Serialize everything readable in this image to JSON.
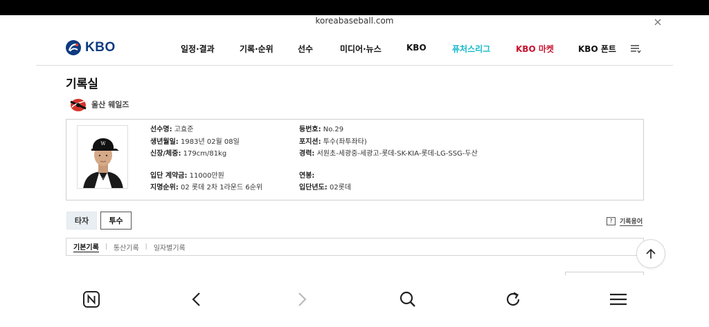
{
  "browser": {
    "url": "koreabaseball.com",
    "close_icon": "close-icon",
    "toolbar": [
      "naver-icon",
      "back-icon",
      "forward-icon",
      "search-icon",
      "refresh-icon",
      "menu-icon"
    ]
  },
  "site": {
    "logo_text": "KBO",
    "nav": {
      "schedule": "일정·결과",
      "records": "기록·순위",
      "players": "선수",
      "media": "미디어·뉴스",
      "kbo": "KBO",
      "futures": "퓨처스리그",
      "market": "KBO 마켓",
      "font": "KBO 폰트"
    },
    "colors": {
      "brand": "#0d3b80",
      "futures": "#14b8c8",
      "market": "#c8102e"
    }
  },
  "page": {
    "title": "기록실",
    "team": "울산 웨일즈"
  },
  "player": {
    "name_label": "선수명:",
    "name": "고효준",
    "birth_label": "생년월일:",
    "birth": "1983년 02월 08일",
    "body_label": "신장/체중:",
    "body": "179cm/81kg",
    "signing_label": "입단 계약금:",
    "signing": "11000만원",
    "draft_label": "지명순위:",
    "draft": "02 롯데 2차 1라운드 6순위",
    "number_label": "등번호:",
    "number": "No.29",
    "position_label": "포지션:",
    "position": "투수(좌투좌타)",
    "career_label": "경력:",
    "career": "서원초-세광중-세광고-롯데-SK-KIA-롯데-LG-SSG-두산",
    "salary_label": "연봉:",
    "salary": "",
    "entry_year_label": "입단년도:",
    "entry_year": "02롯데"
  },
  "tabs": {
    "hitter": "타자",
    "pitcher": "투수",
    "active": "투수"
  },
  "glossary": {
    "icon": "?",
    "label": "기록용어"
  },
  "subtabs": {
    "basic": "기본기록",
    "career_total": "통산기록",
    "daily": "일자별기록",
    "separator": "|",
    "active": "기본기록"
  }
}
